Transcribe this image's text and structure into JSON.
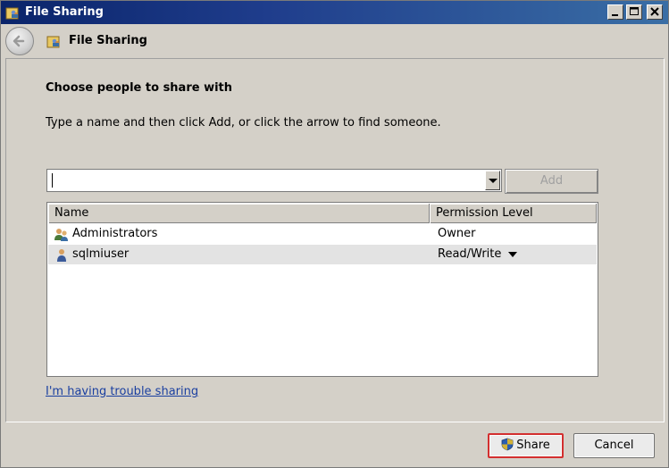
{
  "window": {
    "title": "File Sharing",
    "icon": "file-sharing-icon",
    "controls": [
      "minimize-icon",
      "maximize-icon",
      "close-icon"
    ]
  },
  "nav": {
    "title": "File Sharing",
    "back_icon": "back-arrow-icon"
  },
  "main": {
    "heading": "Choose people to share with",
    "instructions": "Type a name and then click Add, or click the arrow to find someone.",
    "name_input": {
      "value": "",
      "placeholder": ""
    },
    "add_label": "Add",
    "columns": [
      "Name",
      "Permission Level"
    ],
    "rows": [
      {
        "name": "Administrators",
        "permission": "Owner",
        "icon": "group-icon"
      },
      {
        "name": "sqlmiuser",
        "permission": "Read/Write",
        "icon": "user-icon"
      }
    ],
    "trouble_link": "I'm having trouble sharing"
  },
  "footer": {
    "share_label": "Share",
    "cancel_label": "Cancel"
  },
  "colors": {
    "highlight_border": "#d32f2f",
    "link": "#1a3fa0",
    "titlebar": "#0a246a"
  }
}
